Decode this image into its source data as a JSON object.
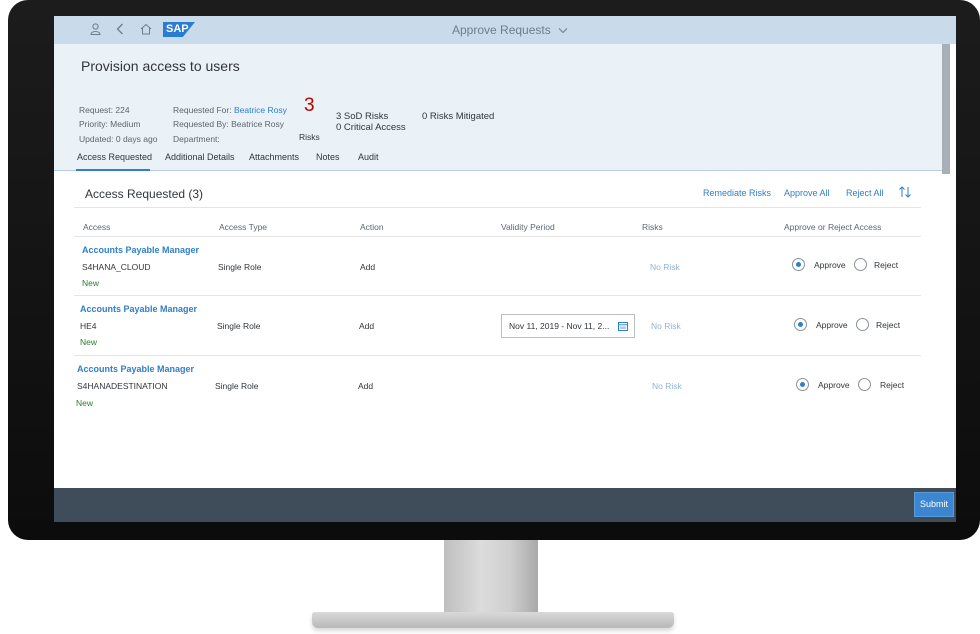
{
  "shell": {
    "title": "Approve Requests",
    "logo_text": "SAP",
    "icons": [
      "person-icon",
      "back-icon",
      "home-icon",
      "chevron-down-icon"
    ]
  },
  "header": {
    "title": "Provision access to users",
    "request": "Request: 224",
    "priority": "Priority: Medium",
    "updated": "Updated: 0 days ago",
    "requested_for_label": "Requested For:",
    "requested_for_value": "Beatrice Rosy",
    "requested_by": "Requested By: Beatrice Rosy",
    "department": "Department:",
    "risk_count": "3",
    "risk_label": "Risks",
    "sod_risks": "3 SoD Risks",
    "critical_access": "0 Critical Access",
    "mitigated": "0 Risks Mitigated"
  },
  "tabs": [
    "Access Requested",
    "Additional Details",
    "Attachments",
    "Notes",
    "Audit"
  ],
  "section": {
    "title": "Access Requested (3)",
    "remediate": "Remediate Risks",
    "approve_all": "Approve All",
    "reject_all": "Reject All"
  },
  "columns": [
    "Access",
    "Access Type",
    "Action",
    "Validity Period",
    "Risks",
    "Approve or Reject Access"
  ],
  "rows": [
    {
      "name": "Accounts Payable Manager",
      "system": "S4HANA_CLOUD",
      "status": "New",
      "type": "Single Role",
      "action": "Add",
      "validity": "",
      "risk": "No Risk",
      "decision": "Approve"
    },
    {
      "name": "Accounts Payable Manager",
      "system": "HE4",
      "status": "New",
      "type": "Single Role",
      "action": "Add",
      "validity": "Nov 11, 2019 - Nov 11, 2...",
      "risk": "No Risk",
      "decision": "Approve"
    },
    {
      "name": "Accounts Payable Manager",
      "system": "S4HANADESTINATION",
      "status": "New",
      "type": "Single Role",
      "action": "Add",
      "validity": "",
      "risk": "No Risk",
      "decision": "Approve"
    }
  ],
  "radio_labels": {
    "approve": "Approve",
    "reject": "Reject"
  },
  "footer": {
    "submit": "Submit"
  },
  "colors": {
    "accent": "#2f7fcb",
    "risk": "#bb0000",
    "new": "#2b7d2b",
    "footer": "#3f4c59"
  }
}
